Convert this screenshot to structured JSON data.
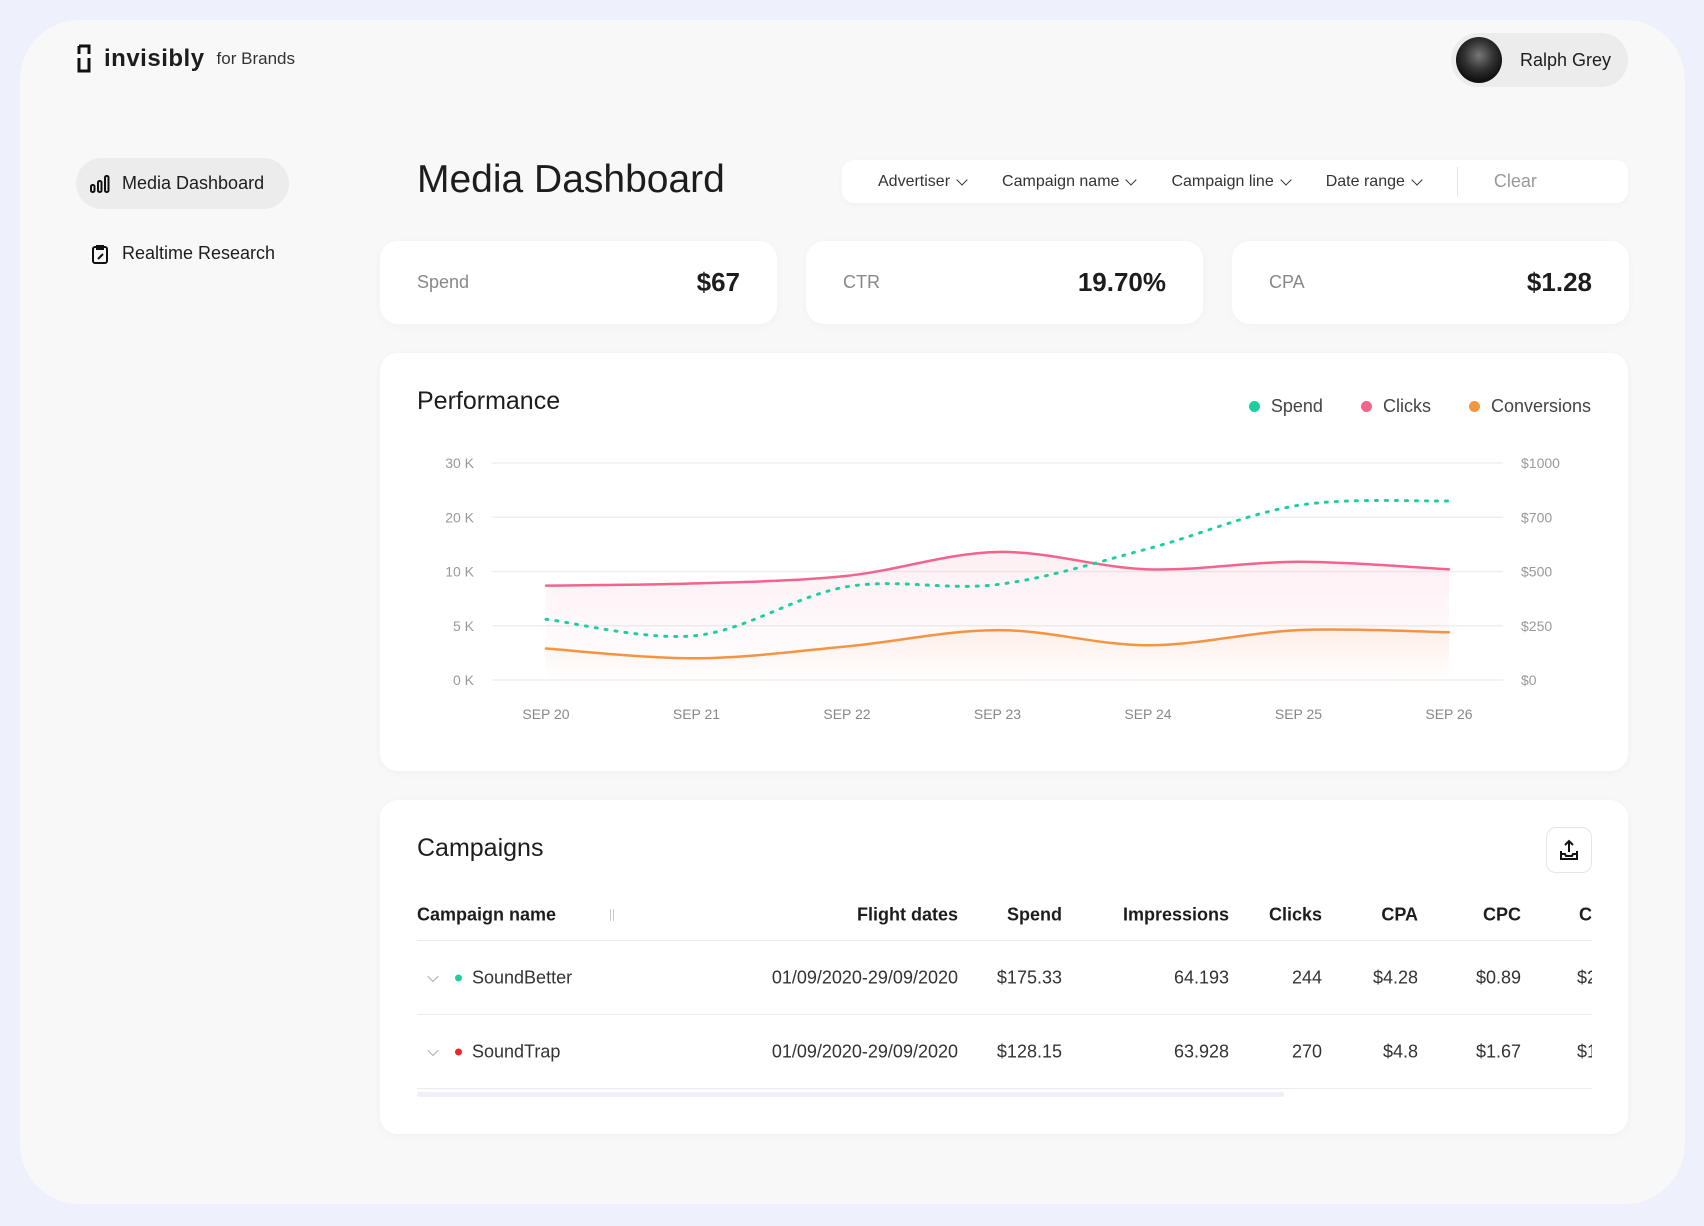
{
  "brand": {
    "name": "invisibly",
    "suffix": "for Brands"
  },
  "user": {
    "name": "Ralph Grey"
  },
  "sidebar": {
    "items": [
      {
        "label": "Media Dashboard",
        "icon": "bar-chart-icon",
        "active": true
      },
      {
        "label": "Realtime Research",
        "icon": "clipboard-edit-icon",
        "active": false
      }
    ]
  },
  "header": {
    "title": "Media Dashboard"
  },
  "filters": {
    "items": [
      "Advertiser",
      "Campaign name",
      "Campaign line",
      "Date range"
    ],
    "clear_label": "Clear"
  },
  "kpis": [
    {
      "label": "Spend",
      "value": "$67"
    },
    {
      "label": "CTR",
      "value": "19.70%"
    },
    {
      "label": "CPA",
      "value": "$1.28"
    }
  ],
  "performance": {
    "title": "Performance"
  },
  "chart_data": {
    "type": "line",
    "title": "Performance",
    "categories": [
      "SEP 20",
      "SEP 21",
      "SEP 22",
      "SEP 23",
      "SEP 24",
      "SEP 25",
      "SEP 26"
    ],
    "left_axis": {
      "ticks": [
        0,
        5000,
        10000,
        20000,
        30000
      ],
      "tick_labels": [
        "0 K",
        "5 K",
        "10 K",
        "20 K",
        "30 K"
      ]
    },
    "right_axis": {
      "ticks": [
        0,
        250,
        500,
        700,
        1000
      ],
      "tick_labels": [
        "$0",
        "$250",
        "$500",
        "$700",
        "$1000"
      ]
    },
    "grid": true,
    "legend_position": "top-right",
    "series": [
      {
        "name": "Spend",
        "axis": "right",
        "style": "dotted",
        "color": "#1ecf9e",
        "values": [
          280,
          205,
          430,
          440,
          584,
          766,
          790
        ]
      },
      {
        "name": "Clicks",
        "axis": "left",
        "style": "solid",
        "color": "#f2648c",
        "values": [
          8700,
          8900,
          9600,
          13600,
          10400,
          11800,
          10400
        ]
      },
      {
        "name": "Conversions",
        "axis": "left",
        "style": "solid",
        "color": "#f5953f",
        "values": [
          2900,
          2000,
          3100,
          4600,
          3200,
          4600,
          4400
        ]
      }
    ]
  },
  "campaigns": {
    "title": "Campaigns",
    "columns": [
      "Campaign name",
      "Flight dates",
      "Spend",
      "Impressions",
      "Clicks",
      "CPA",
      "CPC",
      "C"
    ],
    "rows": [
      {
        "status_color": "#1ecf9e",
        "cells": [
          "SoundBetter",
          "01/09/2020-29/09/2020",
          "$175.33",
          "64.193",
          "244",
          "$4.28",
          "$0.89",
          "$2"
        ]
      },
      {
        "status_color": "#e8262b",
        "cells": [
          "SoundTrap",
          "01/09/2020-29/09/2020",
          "$128.15",
          "63.928",
          "270",
          "$4.8",
          "$1.67",
          "$1"
        ]
      }
    ]
  }
}
